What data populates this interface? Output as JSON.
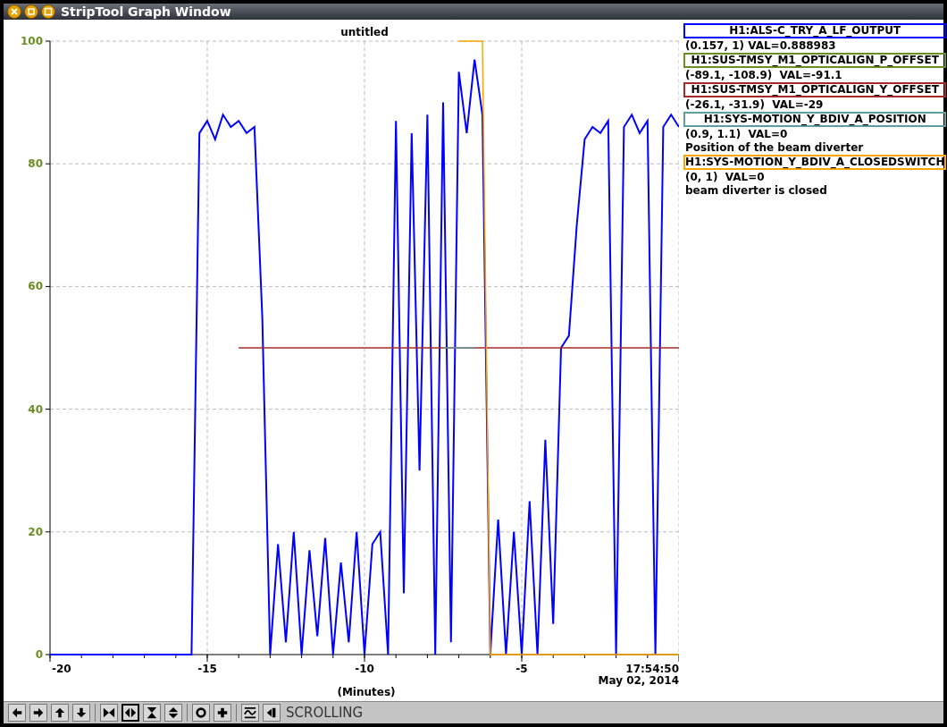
{
  "window": {
    "title": "StripTool Graph Window"
  },
  "chart": {
    "chart_data": {
      "type": "line",
      "title": "untitled",
      "xlabel": "(Minutes)",
      "xlim": [
        -20,
        0
      ],
      "ylim": [
        0,
        100
      ],
      "xticks": [
        -20,
        -15,
        -10,
        -5
      ],
      "grid": true,
      "yticks": [
        0,
        20,
        40,
        60,
        80,
        100
      ],
      "x": [
        -20,
        -19.75,
        -19.5,
        -19.25,
        -19,
        -18.75,
        -18.5,
        -18.25,
        -18,
        -17.75,
        -17.5,
        -17.25,
        -17,
        -16.75,
        -16.5,
        -16.25,
        -16,
        -15.75,
        -15.5,
        -15.25,
        -15,
        -14.75,
        -14.5,
        -14.25,
        -14,
        -13.75,
        -13.5,
        -13.25,
        -13,
        -12.75,
        -12.5,
        -12.25,
        -12,
        -11.75,
        -11.5,
        -11.25,
        -11,
        -10.75,
        -10.5,
        -10.25,
        -10,
        -9.75,
        -9.5,
        -9.25,
        -9,
        -8.75,
        -8.5,
        -8.25,
        -8,
        -7.75,
        -7.5,
        -7.25,
        -7,
        -6.75,
        -6.5,
        -6.25,
        -6,
        -5.75,
        -5.5,
        -5.25,
        -5,
        -4.75,
        -4.5,
        -4.25,
        -4,
        -3.75,
        -3.5,
        -3.25,
        -3,
        -2.75,
        -2.5,
        -2.25,
        -2,
        -1.75,
        -1.5,
        -1.25,
        -1,
        -0.75,
        -0.5,
        -0.25,
        0
      ],
      "series": [
        {
          "color": "#0000ff",
          "values": [
            0,
            0,
            0,
            0,
            0,
            0,
            0,
            0,
            0,
            0,
            0,
            0,
            0,
            0,
            0,
            0,
            0,
            0,
            0,
            85,
            87,
            84,
            88,
            86,
            87,
            85,
            86,
            55,
            0,
            18,
            2,
            20,
            0,
            17,
            3,
            19,
            0,
            15,
            2,
            20,
            0,
            18,
            20,
            0,
            87,
            10,
            85,
            30,
            88,
            0,
            90,
            2,
            95,
            85,
            97,
            88,
            0,
            22,
            0,
            20,
            0,
            25,
            0,
            35,
            5,
            50,
            52,
            70,
            84,
            86,
            85,
            87,
            0,
            86,
            88,
            85,
            87,
            0,
            86,
            88,
            86
          ]
        },
        {
          "color": "#a52a2a",
          "values": [
            null,
            null,
            null,
            null,
            null,
            null,
            null,
            null,
            null,
            null,
            null,
            null,
            null,
            null,
            null,
            null,
            null,
            null,
            null,
            null,
            null,
            null,
            null,
            null,
            50,
            50,
            50,
            50,
            50,
            50,
            50,
            50,
            50,
            50,
            50,
            50,
            50,
            50,
            50,
            50,
            50,
            50,
            50,
            50,
            50,
            50,
            50,
            50,
            50,
            50,
            50,
            50,
            50,
            50,
            50,
            50,
            50,
            50,
            50,
            50,
            50,
            50,
            50,
            50,
            50,
            50,
            50,
            50,
            50,
            50,
            50,
            50,
            50,
            50,
            50,
            50,
            50,
            50,
            50,
            50,
            50
          ]
        },
        {
          "color": "#5f9ea0",
          "values": [
            null,
            null,
            null,
            null,
            null,
            null,
            null,
            null,
            null,
            null,
            null,
            null,
            null,
            null,
            null,
            null,
            null,
            null,
            null,
            null,
            null,
            null,
            null,
            null,
            null,
            null,
            null,
            null,
            null,
            null,
            null,
            null,
            null,
            null,
            null,
            null,
            null,
            null,
            null,
            null,
            null,
            null,
            null,
            null,
            null,
            null,
            null,
            null,
            null,
            null,
            50,
            50,
            50,
            50,
            50,
            null,
            null,
            null,
            null,
            null,
            null,
            null,
            null,
            null,
            null,
            null,
            null,
            null,
            null,
            null,
            null,
            null,
            null,
            null,
            null,
            null,
            null,
            null,
            null,
            null,
            null
          ]
        },
        {
          "color": "#ffa500",
          "values": [
            null,
            null,
            null,
            null,
            null,
            null,
            null,
            null,
            null,
            null,
            null,
            null,
            null,
            null,
            null,
            null,
            null,
            null,
            null,
            null,
            null,
            null,
            null,
            null,
            null,
            null,
            null,
            null,
            null,
            null,
            null,
            null,
            null,
            null,
            null,
            null,
            null,
            null,
            null,
            null,
            null,
            null,
            null,
            null,
            null,
            null,
            null,
            null,
            null,
            null,
            null,
            null,
            100,
            100,
            100,
            100,
            0,
            0,
            0,
            0,
            0,
            0,
            0,
            0,
            0,
            0,
            0,
            0,
            0,
            0,
            0,
            0,
            0,
            0,
            0,
            0,
            0,
            0,
            0,
            0,
            0
          ]
        }
      ]
    },
    "time": "17:54:50",
    "date": "May 02, 2014"
  },
  "legend": [
    {
      "name": "H1:ALS-C_TRY_A_LF_OUTPUT",
      "color": "#0000ff",
      "range": "(0.157, 1) VAL=0.888983"
    },
    {
      "name": "H1:SUS-TMSY_M1_OPTICALIGN_P_OFFSET",
      "color": "#6b8e23",
      "range": "(-89.1, -108.9)  VAL=-91.1"
    },
    {
      "name": "H1:SUS-TMSY_M1_OPTICALIGN_Y_OFFSET",
      "color": "#a52a2a",
      "range": "(-26.1, -31.9)  VAL=-29"
    },
    {
      "name": "H1:SYS-MOTION_Y_BDIV_A_POSITION",
      "color": "#5f9ea0",
      "range": "(0.9, 1.1)  VAL=0",
      "description": "Position of the beam diverter"
    },
    {
      "name": "H1:SYS-MOTION_Y_BDIV_A_CLOSEDSWITCH",
      "color": "#ffa500",
      "range": "(0, 1)  VAL=0",
      "description": "beam diverter is closed"
    }
  ],
  "toolbar": {
    "buttons": [
      {
        "kind": "left",
        "selected": false
      },
      {
        "kind": "right",
        "selected": false
      },
      {
        "kind": "up",
        "selected": false
      },
      {
        "kind": "down",
        "selected": false
      },
      {
        "kind": "zoom-in-x",
        "selected": false
      },
      {
        "kind": "zoom-out-x",
        "selected": true
      },
      {
        "kind": "zoom-in-y",
        "selected": false
      },
      {
        "kind": "zoom-out-y",
        "selected": false
      },
      {
        "kind": "ring",
        "selected": false
      },
      {
        "kind": "plus",
        "selected": false
      },
      {
        "kind": "wave",
        "selected": false
      },
      {
        "kind": "pause",
        "selected": false
      }
    ],
    "mode": "SCROLLING"
  }
}
